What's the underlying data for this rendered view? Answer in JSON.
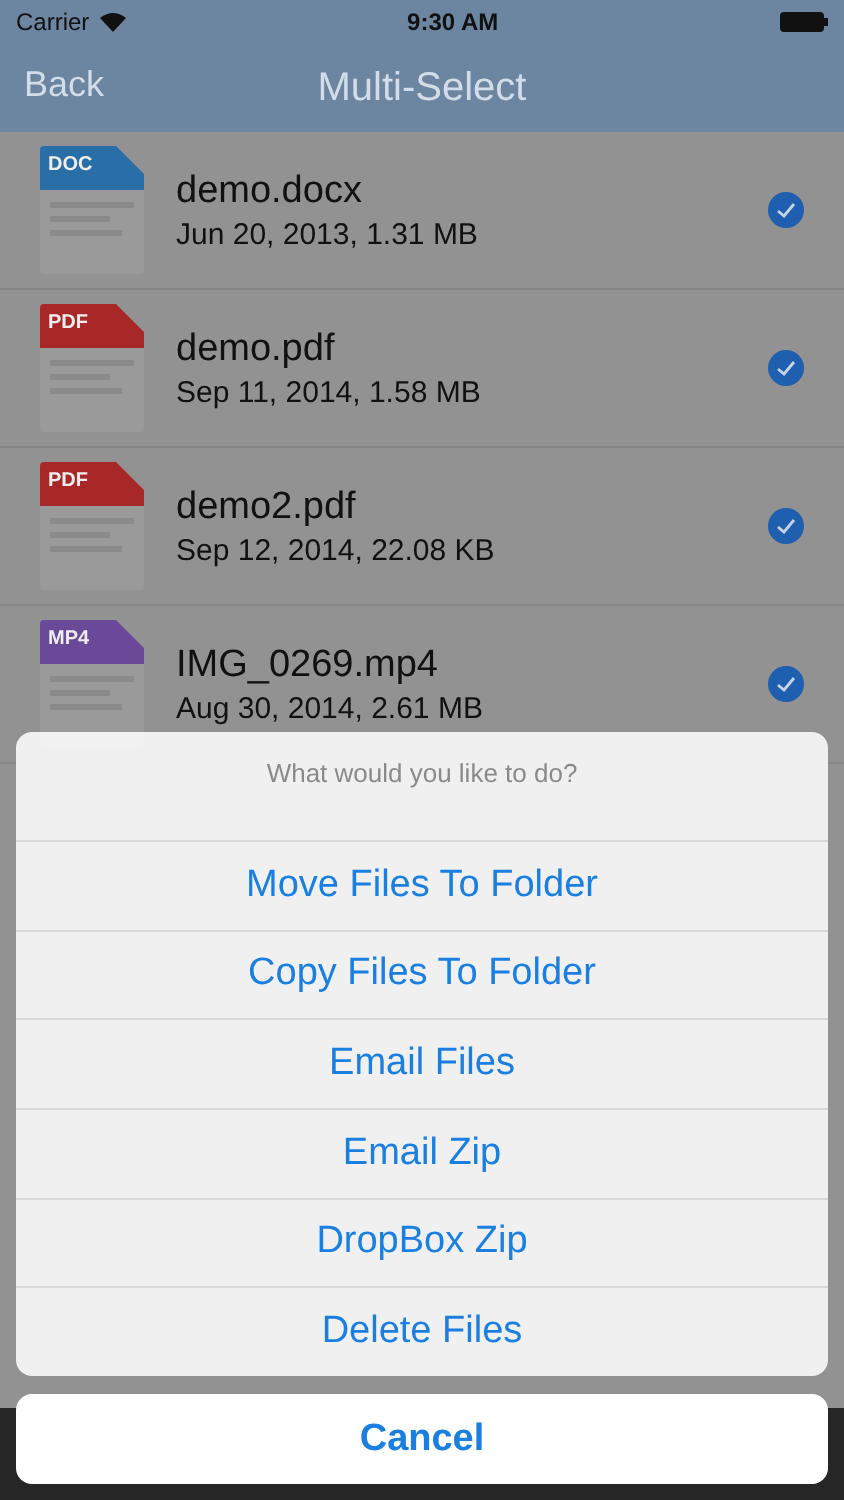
{
  "status_bar": {
    "carrier": "Carrier",
    "time": "9:30 AM"
  },
  "nav_bar": {
    "back": "Back",
    "title": "Multi-Select"
  },
  "files": [
    {
      "kind": "doc",
      "badge": "DOC",
      "name": "demo.docx",
      "details": "Jun 20, 2013, 1.31 MB",
      "selected": true
    },
    {
      "kind": "pdf",
      "badge": "PDF",
      "name": "demo.pdf",
      "details": "Sep 11, 2014, 1.58 MB",
      "selected": true
    },
    {
      "kind": "pdf",
      "badge": "PDF",
      "name": "demo2.pdf",
      "details": "Sep 12, 2014, 22.08 KB",
      "selected": true
    },
    {
      "kind": "mp4",
      "badge": "MP4",
      "name": "IMG_0269.mp4",
      "details": "Aug 30, 2014, 2.61 MB",
      "selected": true
    }
  ],
  "action_sheet": {
    "title": "What would you like to do?",
    "actions": [
      "Move Files To Folder",
      "Copy Files To Folder",
      "Email Files",
      "Email Zip",
      "DropBox Zip",
      "Delete Files"
    ],
    "cancel": "Cancel"
  }
}
